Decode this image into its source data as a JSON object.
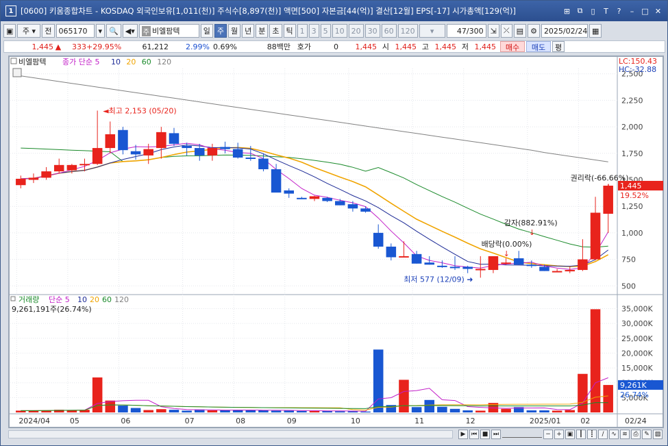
{
  "titlebar": {
    "window_num": "1",
    "text": "[0600] 키움종합차트 - KOSDAQ 외국인보유[1,011(천)] 주식수[8,897(천)] 액면[500] 자본금[44(억)] 결산[12월] EPS[-17] 시가총액[129(억)]"
  },
  "toolbar": {
    "type_label": "주",
    "jeon_label": "전",
    "code": "065170",
    "stock_badge": "주",
    "stock_name": "비엘팜텍",
    "periods": [
      "일",
      "주",
      "월",
      "년",
      "분",
      "초",
      "틱"
    ],
    "selected_period": "주",
    "intervals": [
      "1",
      "3",
      "5",
      "10",
      "20",
      "30",
      "60",
      "120"
    ],
    "count": "47",
    "count_total": "/300",
    "date": "2025/02/24"
  },
  "quote": {
    "price": "1,445",
    "change": "333",
    "change_pct": "+29.95%",
    "volume": "61,212",
    "turnover_pct": "2.99%",
    "ratio": "0.69%",
    "amount": "88백만",
    "hoga_label": "호가",
    "hoga_value": "0",
    "hoga_price": "1,445",
    "open_label": "시",
    "open": "1,445",
    "high_label": "고",
    "high": "1,445",
    "low_label": "저",
    "low": "1,445",
    "buy": "매수",
    "sell": "매도",
    "avg": "평"
  },
  "legend": {
    "name": "비엘팜텍",
    "price_ma": "종가 단순 5",
    "ma": [
      "10",
      "20",
      "60",
      "120"
    ],
    "vol_name": "거래량",
    "vol_ma": "단순 5",
    "vol_current": "9,261,191주(26.74%)"
  },
  "right_labels": {
    "lc": "LC:150.43",
    "hc": "HC:-32.88",
    "price_tag": "1,445",
    "price_pct": "19.52%",
    "vol_tag": "9,261K",
    "vol_pct": "26.74%"
  },
  "annotations": {
    "high": "최고 2,153 (05/20)",
    "low": "최저 577 (12/09)",
    "dividend": "배당락(0.00%)",
    "reduction": "감자(882.91%)",
    "rights": "권리락(-66.66%)"
  },
  "colors": {
    "up": "#e8231c",
    "down": "#1957d2",
    "ma5": "#c21fc8",
    "ma10": "#1c2a96",
    "ma20": "#f0a400",
    "ma60": "#1a8a2a",
    "ma120": "#808080"
  },
  "chart_data": [
    {
      "type": "candlestick",
      "title": "",
      "x_labels": [
        "2024/04",
        "05",
        "06",
        "07",
        "08",
        "09",
        "10",
        "11",
        "12",
        "2025/01",
        "02",
        "02/24"
      ],
      "ylim": [
        500,
        2500
      ],
      "y_ticks": [
        500,
        750,
        1000,
        1250,
        1500,
        1750,
        2000,
        2250,
        2500
      ],
      "series": [
        {
          "name": "비엘팜텍",
          "ohlc": [
            [
              1450,
              1540,
              1420,
              1510
            ],
            [
              1500,
              1560,
              1470,
              1520
            ],
            [
              1520,
              1620,
              1500,
              1580
            ],
            [
              1580,
              1700,
              1560,
              1640
            ],
            [
              1590,
              1650,
              1560,
              1640
            ],
            [
              1640,
              1700,
              1580,
              1650
            ],
            [
              1650,
              2153,
              1640,
              1800
            ],
            [
              1800,
              2050,
              1750,
              1930
            ],
            [
              1970,
              2000,
              1740,
              1780
            ],
            [
              1770,
              1830,
              1690,
              1740
            ],
            [
              1730,
              1840,
              1650,
              1790
            ],
            [
              1800,
              2000,
              1700,
              1950
            ],
            [
              1940,
              1990,
              1820,
              1840
            ],
            [
              1820,
              1850,
              1730,
              1800
            ],
            [
              1800,
              1840,
              1680,
              1730
            ],
            [
              1730,
              1840,
              1680,
              1800
            ],
            [
              1810,
              1860,
              1750,
              1790
            ],
            [
              1790,
              1850,
              1700,
              1710
            ],
            [
              1710,
              1820,
              1680,
              1700
            ],
            [
              1700,
              1750,
              1580,
              1600
            ],
            [
              1600,
              1650,
              1400,
              1380
            ],
            [
              1400,
              1420,
              1330,
              1370
            ],
            [
              1330,
              1340,
              1320,
              1325
            ],
            [
              1320,
              1350,
              1300,
              1345
            ],
            [
              1330,
              1340,
              1290,
              1300
            ],
            [
              1300,
              1320,
              1260,
              1260
            ],
            [
              1270,
              1300,
              1200,
              1230
            ],
            [
              1230,
              1250,
              1190,
              1200
            ],
            [
              1000,
              1080,
              850,
              870
            ],
            [
              870,
              900,
              740,
              770
            ],
            [
              770,
              920,
              770,
              780
            ],
            [
              800,
              830,
              710,
              710
            ],
            [
              720,
              780,
              700,
              700
            ],
            [
              690,
              740,
              670,
              680
            ],
            [
              680,
              780,
              650,
              670
            ],
            [
              680,
              690,
              620,
              660
            ],
            [
              650,
              780,
              577,
              660
            ],
            [
              650,
              740,
              620,
              780
            ],
            [
              720,
              760,
              700,
              720
            ],
            [
              760,
              830,
              700,
              700
            ],
            [
              700,
              740,
              670,
              690
            ],
            [
              680,
              700,
              640,
              640
            ],
            [
              640,
              660,
              630,
              640
            ],
            [
              650,
              680,
              620,
              650
            ],
            [
              650,
              940,
              640,
              750
            ],
            [
              750,
              1340,
              740,
              1190
            ],
            [
              1180,
              1460,
              1000,
              1445
            ]
          ]
        }
      ],
      "ma_lines": [
        "종가 단순 5",
        "10",
        "20",
        "60",
        "120"
      ]
    },
    {
      "type": "bar",
      "title": "거래량",
      "ylim": [
        0,
        36000
      ],
      "y_unit": "K",
      "y_ticks": [
        "5,000K",
        "10,000K",
        "15,000K",
        "20,000K",
        "25,000K",
        "30,000K",
        "35,000K"
      ],
      "values": [
        600,
        600,
        700,
        900,
        800,
        900,
        11800,
        4000,
        2300,
        1500,
        800,
        1100,
        900,
        600,
        1000,
        700,
        700,
        900,
        700,
        800,
        600,
        600,
        500,
        500,
        500,
        400,
        400,
        300,
        21200,
        2500,
        11000,
        1800,
        4200,
        1900,
        1200,
        700,
        600,
        3200,
        1200,
        1800,
        700,
        700,
        600,
        800,
        13000,
        34800,
        9261
      ]
    }
  ]
}
